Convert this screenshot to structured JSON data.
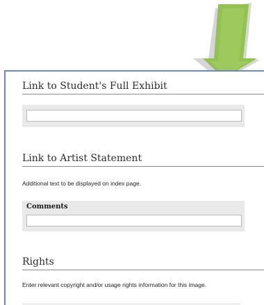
{
  "sections": {
    "full_exhibit": {
      "title": "Link to Student's Full Exhibit",
      "value": ""
    },
    "artist_statement": {
      "title": "Link to Artist Statement",
      "help": "Additional text to be displayed on index page.",
      "comments_label": "Comments",
      "comments_value": ""
    },
    "rights": {
      "title": "Rights",
      "help": "Enter relevant copyright and/or usage rights information for this image."
    }
  },
  "colors": {
    "arrow_fill": "#93c253",
    "arrow_shadow": "#c9c9c9",
    "panel_border": "#6f89b5",
    "field_box": "#e9e9e9"
  },
  "icons": {
    "callout_arrow": "down-arrow-icon"
  }
}
